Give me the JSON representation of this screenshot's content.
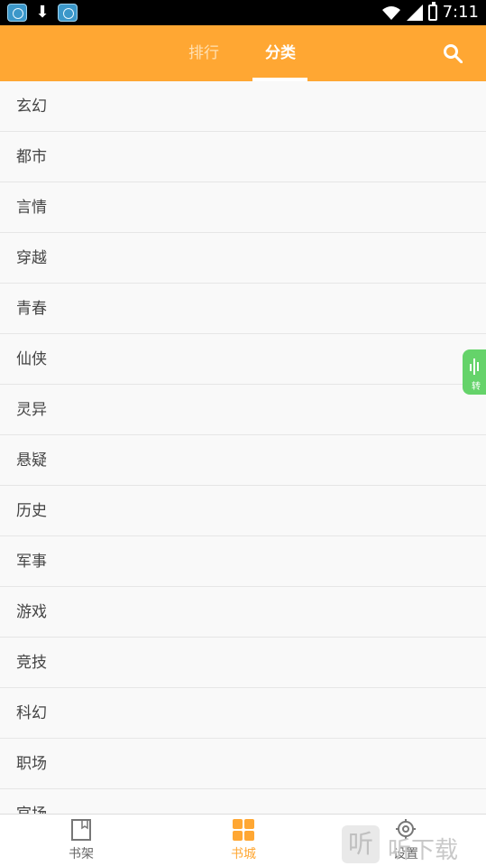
{
  "status_bar": {
    "time": "7:11",
    "icons": [
      "app-icon",
      "app-icon",
      "download-icon",
      "wifi-icon",
      "signal-icon",
      "battery-icon"
    ]
  },
  "header": {
    "tabs": [
      {
        "label": "排行",
        "active": false
      },
      {
        "label": "分类",
        "active": true
      }
    ],
    "search_icon": "search-icon",
    "accent_color": "#ffa733"
  },
  "categories": [
    "玄幻",
    "都市",
    "言情",
    "穿越",
    "青春",
    "仙侠",
    "灵异",
    "悬疑",
    "历史",
    "军事",
    "游戏",
    "竞技",
    "科幻",
    "职场",
    "官场"
  ],
  "floating_button": {
    "label": "转",
    "icon": "audio-icon",
    "color": "#65d36a"
  },
  "bottom_nav": [
    {
      "label": "书架",
      "icon": "bookshelf-icon",
      "active": false
    },
    {
      "label": "书城",
      "icon": "bookstore-icon",
      "active": true
    },
    {
      "label": "设置",
      "icon": "settings-icon",
      "active": false
    }
  ],
  "watermark": {
    "icon_text": "听",
    "text": "听下载"
  }
}
